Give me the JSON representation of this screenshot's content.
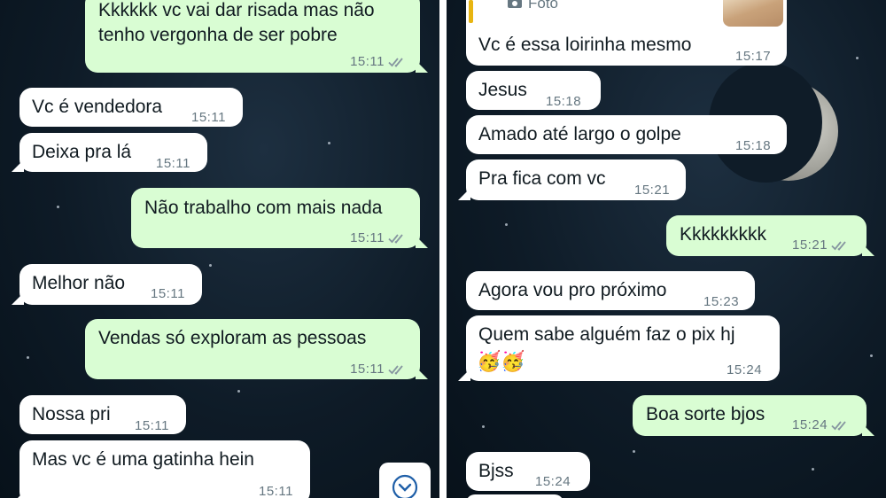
{
  "left_panel": {
    "messages": [
      {
        "text_line1": "Kkkkkk vc vai dar risada mas não",
        "text_line2": "tenho vergonha de ser pobre",
        "time": "15:11"
      },
      {
        "text": "Vc é vendedora",
        "time": "15:11"
      },
      {
        "text": "Deixa pra lá",
        "time": "15:11"
      },
      {
        "text": "Não trabalho com mais nada",
        "time": "15:11"
      },
      {
        "text": "Melhor não",
        "time": "15:11"
      },
      {
        "text": "Vendas só exploram as pessoas",
        "time": "15:11"
      },
      {
        "text": "Nossa pri",
        "time": "15:11"
      },
      {
        "text": "Mas vc é uma gatinha hein",
        "time": "15:11"
      }
    ],
    "scroll_icon": "chevron-down-circle-icon"
  },
  "right_panel": {
    "quoted": {
      "label": "Foto",
      "icon": "camera-icon"
    },
    "messages": [
      {
        "text": "Vc é essa loirinha mesmo",
        "time": "15:17"
      },
      {
        "text": "Jesus",
        "time": "15:18"
      },
      {
        "text": "Amado até largo o golpe",
        "time": "15:18"
      },
      {
        "text": "Pra fica com vc",
        "time": "15:21"
      },
      {
        "text": "Kkkkkkkkk",
        "time": "15:21"
      },
      {
        "text": "Agora vou pro próximo",
        "time": "15:23"
      },
      {
        "text": "Quem sabe alguém faz o pix hj",
        "emoji": "🥳🥳",
        "time": "15:24"
      },
      {
        "text": "Boa sorte bjos",
        "time": "15:24"
      },
      {
        "text": "Bjss",
        "time": "15:24"
      }
    ]
  },
  "colors": {
    "incoming_bubble": "#ffffff",
    "outgoing_bubble": "#d9fdd3",
    "read_ticks": "#8696a0",
    "background": "#0e1b27"
  }
}
